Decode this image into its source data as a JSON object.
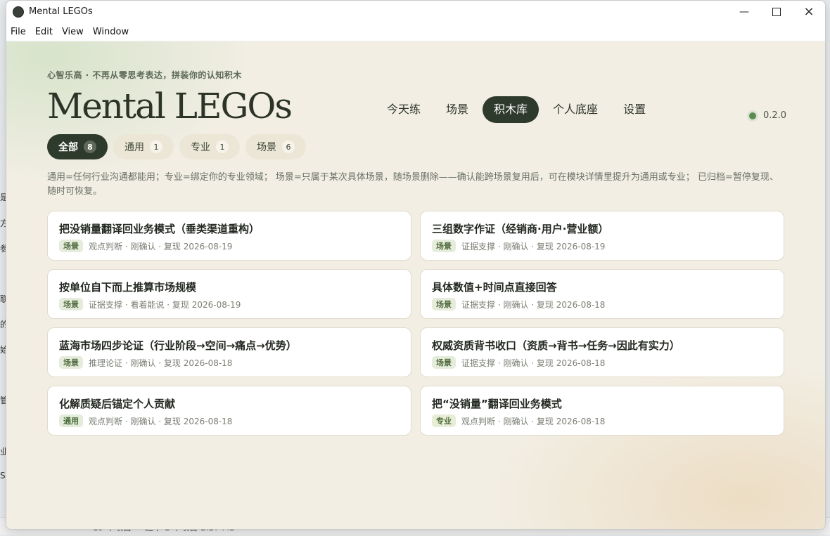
{
  "window": {
    "title": "Mental LEGOs"
  },
  "menubar": [
    "File",
    "Edit",
    "View",
    "Window"
  ],
  "header": {
    "tagline": "心智乐高 · 不再从零思考表达，拼装你的认知积木",
    "logo": "Mental LEGOs",
    "version": "0.2.0"
  },
  "nav": [
    "今天练",
    "场景",
    "积木库",
    "个人底座",
    "设置"
  ],
  "nav_active": "积木库",
  "filters": [
    {
      "label": "全部",
      "count": "8",
      "active": true
    },
    {
      "label": "通用",
      "count": "1",
      "active": false
    },
    {
      "label": "专业",
      "count": "1",
      "active": false
    },
    {
      "label": "场景",
      "count": "6",
      "active": false
    }
  ],
  "description": "通用=任何行业沟通都能用；专业=绑定你的专业领域；  场景=只属于某次具体场景，随场景删除——确认能跨场景复用后，可在模块详情里提升为通用或专业；  已归档=暂停复现、随时可恢复。",
  "cards": [
    {
      "title": "把没销量翻译回业务模式（垂类渠道重构）",
      "badge": "场景",
      "meta": "观点判断 · 刚确认 · 复现 2026-08-19"
    },
    {
      "title": "三组数字作证（经销商·用户·营业额）",
      "badge": "场景",
      "meta": "证据支撑 · 刚确认 · 复现 2026-08-19"
    },
    {
      "title": "按单位自下而上推算市场规模",
      "badge": "场景",
      "meta": "证据支撑 · 看着能说 · 复现 2026-08-19"
    },
    {
      "title": "具体数值+时间点直接回答",
      "badge": "场景",
      "meta": "证据支撑 · 刚确认 · 复现 2026-08-18"
    },
    {
      "title": "蓝海市场四步论证（行业阶段→空间→痛点→优势）",
      "badge": "场景",
      "meta": "推理论证 · 刚确认 · 复现 2026-08-18"
    },
    {
      "title": "权威资质背书收口（资质→背书→任务→因此有实力）",
      "badge": "场景",
      "meta": "证据支撑 · 刚确认 · 复现 2026-08-18"
    },
    {
      "title": "化解质疑后锚定个人贡献",
      "badge": "通用",
      "meta": "观点判断 · 刚确认 · 复现 2026-08-18"
    },
    {
      "title": "把“没销量”翻译回业务模式",
      "badge": "专业",
      "meta": "观点判断 · 刚确认 · 复现 2026-08-18"
    }
  ],
  "background": {
    "left_fragments": [
      "是",
      "方",
      "参",
      "联",
      "的",
      "始",
      "管",
      "业",
      "S"
    ],
    "status_items": "19 个项目",
    "status_selected": "选中 1 个项目  2.27 MB"
  }
}
